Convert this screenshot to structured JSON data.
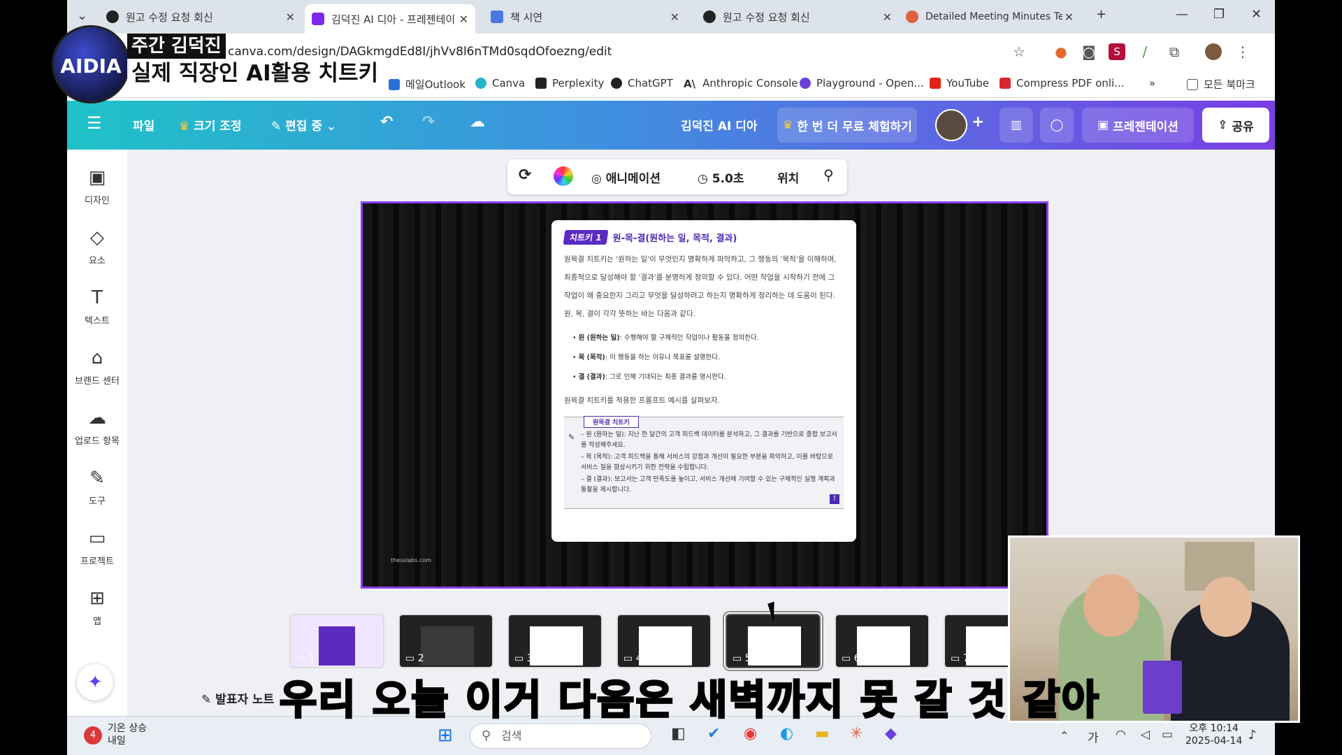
{
  "browser": {
    "tabs": [
      {
        "title": "원고 수정 요청 회신",
        "active": false
      },
      {
        "title": "김덕진 AI 디아 - 프레젠테이션",
        "active": true
      },
      {
        "title": "책 시연",
        "active": false
      },
      {
        "title": "원고 수정 요청 회신",
        "active": false
      },
      {
        "title": "Detailed Meeting Minutes Tem",
        "active": false
      }
    ],
    "new_tab": "+",
    "url": "canva.com/design/DAGkmgdEd8I/jhVv8l6nTMd0sqdOfoezng/edit",
    "bookmarks": [
      "메일Outlook",
      "Canva",
      "Perplexity",
      "ChatGPT",
      "Anthropic Console",
      "Playground - Open...",
      "YouTube",
      "Compress PDF onli..."
    ],
    "bookmarks_more": "»",
    "all_bookmarks": "모든 북마크"
  },
  "canva_header": {
    "file": "파일",
    "resize": "크기 조정",
    "editing": "편집 중",
    "doc_title": "김덕진 AI 디아",
    "trial": "한 번 더 무료 체험하기",
    "present": "프레젠테이션",
    "share": "공유"
  },
  "sidebar": [
    {
      "label": "디자인",
      "icon": "design-icon"
    },
    {
      "label": "요소",
      "icon": "elements-icon"
    },
    {
      "label": "텍스트",
      "icon": "text-icon"
    },
    {
      "label": "브랜드 센터",
      "icon": "brand-icon"
    },
    {
      "label": "업로드 항목",
      "icon": "upload-icon"
    },
    {
      "label": "도구",
      "icon": "draw-icon"
    },
    {
      "label": "프로젝트",
      "icon": "folder-icon"
    },
    {
      "label": "앱",
      "icon": "apps-icon"
    }
  ],
  "context_toolbar": {
    "animation": "애니메이션",
    "duration": "5.0초",
    "position": "위치"
  },
  "slide": {
    "tag": "치트키 1",
    "heading": "원-목-결(원하는 일, 목적, 결과)",
    "paragraph": "원목결 치트키는 '원하는 일'이 무엇인지 명확하게 파악하고, 그 행동의 '목적'을 이해하며, 최종적으로 달성해야 할 '결과'를 분명하게 정의할 수 있다. 어떤 작업을 시작하기 전에 그 작업이 왜 중요한지 그리고 무엇을 달성하려고 하는지 명확하게 정리하는 데 도움이 된다. 원, 목, 결이 각각 뜻하는 바는 다음과 같다.",
    "bullets": [
      {
        "term": "원 (원하는 일)",
        "text": ": 수행해야 할 구체적인 작업이나 활동을 정의한다."
      },
      {
        "term": "목 (목적)",
        "text": ": 이 행동을 하는 이유나 목표를 설명한다."
      },
      {
        "term": "결 (결과)",
        "text": ": 그로 인해 기대되는 최종 결과를 명시한다."
      }
    ],
    "paragraph2": "원목결 치트키를 적용한 프롬프트 예시를 살펴보자.",
    "box_tag": "원목결 치트키",
    "box_lines": [
      "– 원 (원하는 일): 지난 한 달간의 고객 피드백 데이터를 분석하고, 그 결과를 기반으로 종합 보고서를 작성해주세요.",
      "– 목 (목적): 고객 피드백을 통해 서비스의 강점과 개선이 필요한 부분을 파악하고, 이를 바탕으로 서비스 질을 향상시키기 위한 전략을 수립합니다.",
      "– 결 (결과): 보고서는 고객 만족도를 높이고, 서비스 개선에 기여할 수 있는 구체적인 실행 계획과 통찰을 제시합니다."
    ],
    "credit": "thesxlabs.com"
  },
  "thumbnails": [
    "1",
    "2",
    "3",
    "4",
    "5",
    "6",
    "7"
  ],
  "selected_thumbnail": "5",
  "footer": {
    "notes": "발표자 노트"
  },
  "overlay": {
    "logo": "AIDIA",
    "line1": "주간 김덕진",
    "line2": "실제 직장인 AI활용 치트키",
    "subtitle": "우리 오늘 이거 다음은 새벽까지 못 갈 것 같아"
  },
  "taskbar": {
    "weather_title": "기온 상승",
    "weather_sub": "내일",
    "badge": "4",
    "search": "검색",
    "ime": "가",
    "time": "오후 10:14",
    "date": "2025-04-14"
  },
  "colors": {
    "accent": "#8b3dff",
    "header_start": "#1fc2c8",
    "header_end": "#7a3fe4",
    "subtitle": "#ffe94a"
  }
}
